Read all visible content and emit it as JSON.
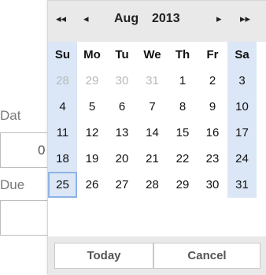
{
  "background_form": {
    "label_date": "Dat",
    "input_date_value": "0",
    "label_due": "Due"
  },
  "picker": {
    "nav": {
      "prev_year": "◂◂",
      "prev_month": "◂",
      "next_month": "▸",
      "next_year": "▸▸"
    },
    "month": "Aug",
    "year": "2013",
    "weekdays": [
      "Su",
      "Mo",
      "Tu",
      "We",
      "Th",
      "Fr",
      "Sa"
    ],
    "weeks": [
      [
        "28",
        "29",
        "30",
        "31",
        "1",
        "2",
        "3"
      ],
      [
        "4",
        "5",
        "6",
        "7",
        "8",
        "9",
        "10"
      ],
      [
        "11",
        "12",
        "13",
        "14",
        "15",
        "16",
        "17"
      ],
      [
        "18",
        "19",
        "20",
        "21",
        "22",
        "23",
        "24"
      ],
      [
        "25",
        "26",
        "27",
        "28",
        "29",
        "30",
        "31"
      ]
    ],
    "outside_month_days": "28,29,30,31",
    "selected_day": "25",
    "buttons": {
      "today": "Today",
      "cancel": "Cancel"
    },
    "colors": {
      "weekend_column": "#dbe6f7",
      "selected_border": "#8fb3e6",
      "header_bg": "#e9e9e9",
      "dim_text": "#b9b9b9"
    }
  }
}
